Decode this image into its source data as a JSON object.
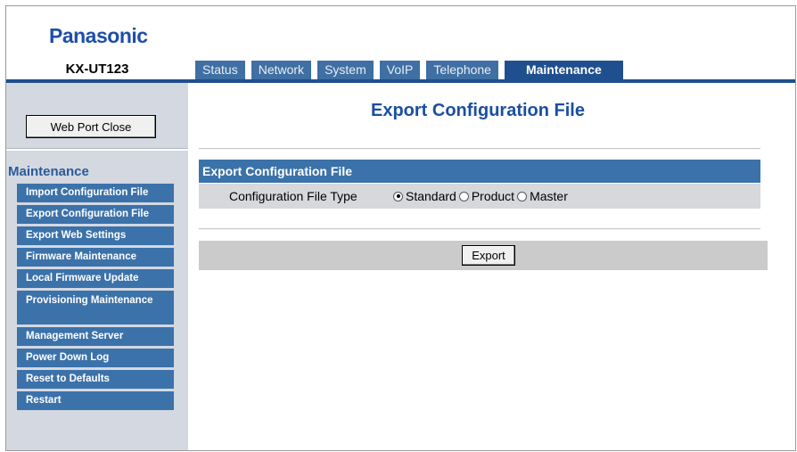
{
  "header": {
    "brand": "Panasonic",
    "model": "KX-UT123"
  },
  "tabs": [
    {
      "label": "Status",
      "active": false
    },
    {
      "label": "Network",
      "active": false
    },
    {
      "label": "System",
      "active": false
    },
    {
      "label": "VoIP",
      "active": false
    },
    {
      "label": "Telephone",
      "active": false
    },
    {
      "label": "Maintenance",
      "active": true
    }
  ],
  "sidebar": {
    "web_port_close_label": "Web Port Close",
    "section_title": "Maintenance",
    "items": [
      {
        "label": "Import Configuration File"
      },
      {
        "label": "Export Configuration File"
      },
      {
        "label": "Export Web Settings"
      },
      {
        "label": "Firmware Maintenance"
      },
      {
        "label": "Local Firmware Update"
      },
      {
        "label": "Provisioning Maintenance"
      },
      {
        "label": "Management Server"
      },
      {
        "label": "Power Down Log"
      },
      {
        "label": "Reset to Defaults"
      },
      {
        "label": "Restart"
      }
    ]
  },
  "main": {
    "page_title": "Export Configuration File",
    "section_header": "Export Configuration File",
    "field_label": "Configuration File Type",
    "radio_options": [
      {
        "label": "Standard",
        "selected": true
      },
      {
        "label": "Product",
        "selected": false
      },
      {
        "label": "Master",
        "selected": false
      }
    ],
    "export_label": "Export"
  },
  "colors": {
    "brand_blue": "#1d4fa8",
    "tab_blue": "#3f6fa3",
    "active_tab_blue": "#1f4f8e",
    "menu_blue": "#3c72aa",
    "sidebar_bg": "#d3d8e1",
    "row_bg": "#d6d8dc"
  }
}
